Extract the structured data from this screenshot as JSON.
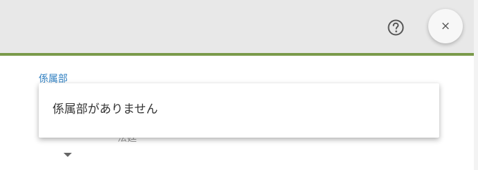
{
  "header": {
    "help_icon": "question-circle-icon",
    "close_icon": "close-icon",
    "close_glyph": "×",
    "background": "#e8e8e8",
    "accent_line_color": "#7a9a4a"
  },
  "form": {
    "department_label": "係属部",
    "department_label_color": "#2f7fc1",
    "department_select": {
      "dropdown_arrow_icon": "caret-down-icon",
      "behind_text": "法廷"
    },
    "dropdown": {
      "empty_message": "係属部がありません"
    }
  }
}
